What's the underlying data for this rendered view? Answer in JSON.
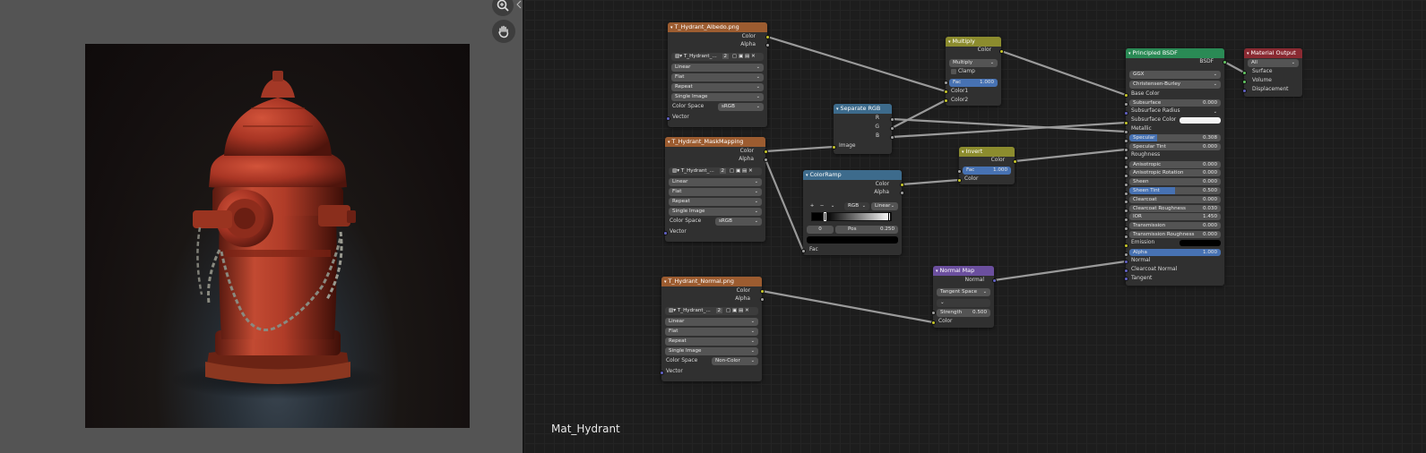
{
  "material_name": "Mat_Hydrant",
  "viewport": {
    "tools": [
      "zoom-icon",
      "hand-pan-icon"
    ]
  },
  "colors": {
    "image_header": "#9c5c30",
    "vector_header": "#6b4f9e",
    "input_header": "#3d6b8c",
    "color_header": "#8c8c2e",
    "shader_header": "#2a8a55",
    "output_header": "#8a2a32",
    "sock_color": "#c7c729",
    "sock_gray": "#a1a1a1",
    "sock_vector": "#6363c7",
    "sock_shader": "#63c763"
  },
  "nodes": {
    "albedo": {
      "title": "T_Hydrant_Albedo.png",
      "outputs": [
        "Color",
        "Alpha"
      ],
      "image_name": "T_Hydrant_...",
      "users": "2",
      "dropdowns": [
        "Linear",
        "Flat",
        "Repeat",
        "Single Image"
      ],
      "colorspace_label": "Color Space",
      "colorspace": "sRGB",
      "input": "Vector"
    },
    "mask": {
      "title": "T_Hydrant_MaskMapping",
      "outputs": [
        "Color",
        "Alpha"
      ],
      "image_name": "T_Hydrant_...",
      "users": "2",
      "dropdowns": [
        "Linear",
        "Flat",
        "Repeat",
        "Single Image"
      ],
      "colorspace_label": "Color Space",
      "colorspace": "sRGB",
      "input": "Vector"
    },
    "normal_tex": {
      "title": "T_Hydrant_Normal.png",
      "outputs": [
        "Color",
        "Alpha"
      ],
      "image_name": "T_Hydrant_...",
      "users": "2",
      "dropdowns": [
        "Linear",
        "Flat",
        "Repeat",
        "Single Image"
      ],
      "colorspace_label": "Color Space",
      "colorspace": "Non-Color",
      "input": "Vector"
    },
    "separate": {
      "title": "Separate RGB",
      "outputs": [
        "R",
        "G",
        "B"
      ],
      "input": "Image"
    },
    "colorramp": {
      "title": "ColorRamp",
      "outputs": [
        "Color",
        "Alpha"
      ],
      "plus": "+",
      "minus": "−",
      "arrow": "⌄",
      "mode": "RGB",
      "interp": "Linear",
      "index": "0",
      "pos_label": "Pos",
      "pos": "0.250",
      "input": "Fac"
    },
    "multiply": {
      "title": "Multiply",
      "output": "Color",
      "blend": "Multiply",
      "clamp": "Clamp",
      "fac_label": "Fac",
      "fac": "1.000",
      "inputs": [
        "Color1",
        "Color2"
      ]
    },
    "invert": {
      "title": "Invert",
      "output": "Color",
      "fac_label": "Fac",
      "fac": "1.000",
      "input": "Color"
    },
    "normalmap": {
      "title": "Normal Map",
      "output": "Normal",
      "space": "Tangent Space",
      "strength_label": "Strength",
      "strength": "0.500",
      "input": "Color"
    },
    "bsdf": {
      "title": "Principled BSDF",
      "output": "BSDF",
      "distribution": "GGX",
      "subsurface_method": "Christensen-Burley",
      "base_color": "Base Color",
      "props": [
        {
          "label": "Subsurface",
          "value": "0.000"
        },
        {
          "label": "Subsurface Radius",
          "value": ""
        },
        {
          "label": "Subsurface Color",
          "value": ""
        },
        {
          "label": "Metallic",
          "value": ""
        },
        {
          "label": "Specular",
          "value": "0.308",
          "fill": 0.308
        },
        {
          "label": "Specular Tint",
          "value": "0.000"
        },
        {
          "label": "Roughness",
          "value": ""
        },
        {
          "label": "Anisotropic",
          "value": "0.000"
        },
        {
          "label": "Anisotropic Rotation",
          "value": "0.000"
        },
        {
          "label": "Sheen",
          "value": "0.000"
        },
        {
          "label": "Sheen Tint",
          "value": "0.500",
          "fill": 0.5
        },
        {
          "label": "Clearcoat",
          "value": "0.000"
        },
        {
          "label": "Clearcoat Roughness",
          "value": "0.030"
        },
        {
          "label": "IOR",
          "value": "1.450"
        },
        {
          "label": "Transmission",
          "value": "0.000"
        },
        {
          "label": "Transmission Roughness",
          "value": "0.000"
        },
        {
          "label": "Emission",
          "value": ""
        },
        {
          "label": "Alpha",
          "value": "1.000",
          "fill": 1.0
        }
      ],
      "inputs_tail": [
        "Normal",
        "Clearcoat Normal",
        "Tangent"
      ]
    },
    "output": {
      "title": "Material Output",
      "target": "All",
      "inputs": [
        "Surface",
        "Volume",
        "Displacement"
      ]
    }
  }
}
